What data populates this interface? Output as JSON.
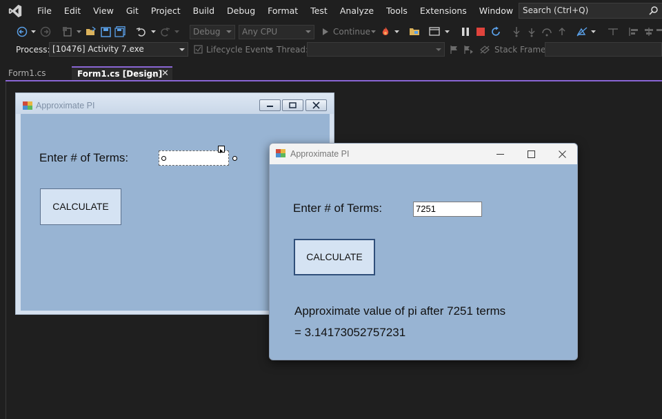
{
  "menu": {
    "items": [
      "File",
      "Edit",
      "View",
      "Git",
      "Project",
      "Build",
      "Debug",
      "Format",
      "Test",
      "Analyze",
      "Tools",
      "Extensions",
      "Window",
      "Help"
    ],
    "search_placeholder": "Search (Ctrl+Q)"
  },
  "toolbar": {
    "config": "Debug",
    "platform": "Any CPU",
    "continue_label": "Continue"
  },
  "debug_bar": {
    "process_label": "Process:",
    "process_value": "[10476] Activity 7.exe",
    "lifecycle_label": "Lifecycle Events",
    "thread_label": "Thread:",
    "stack_frame_label": "Stack Frame:"
  },
  "tabs": [
    {
      "label": "Form1.cs",
      "active": false
    },
    {
      "label": "Form1.cs [Design]",
      "active": true
    }
  ],
  "designer_form": {
    "title": "Approximate PI",
    "terms_label": "Enter # of Terms:",
    "terms_value": "",
    "button_label": "CALCULATE"
  },
  "running_form": {
    "title": "Approximate PI",
    "terms_label": "Enter # of Terms:",
    "terms_value": "7251",
    "button_label": "CALCULATE",
    "result_line1": "Approximate value of pi after 7251 terms",
    "result_line2": "= 3.14173052757231"
  },
  "colors": {
    "form_background": "#98b4d3",
    "button_background": "#d5e3f3",
    "ide_background": "#1f1f1f",
    "accent": "#8a66d6"
  }
}
